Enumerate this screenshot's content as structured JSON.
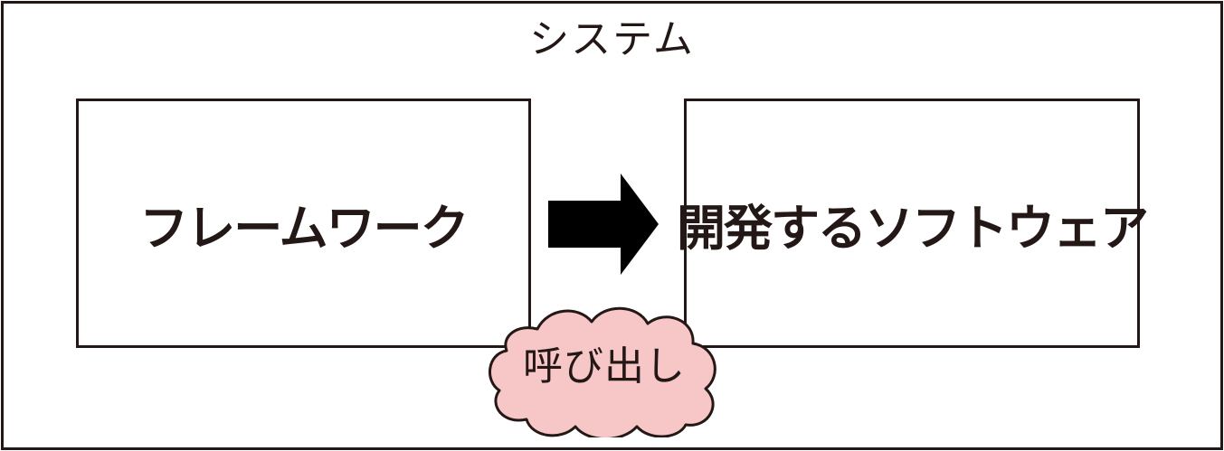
{
  "system": {
    "label": "システム"
  },
  "framework": {
    "label": "フレームワーク"
  },
  "software": {
    "label": "開発するソフトウェア"
  },
  "callout": {
    "label": "呼び出し"
  },
  "colors": {
    "line": "#231815",
    "cloud_fill": "#f7c6c7",
    "arrow": "#000000"
  }
}
